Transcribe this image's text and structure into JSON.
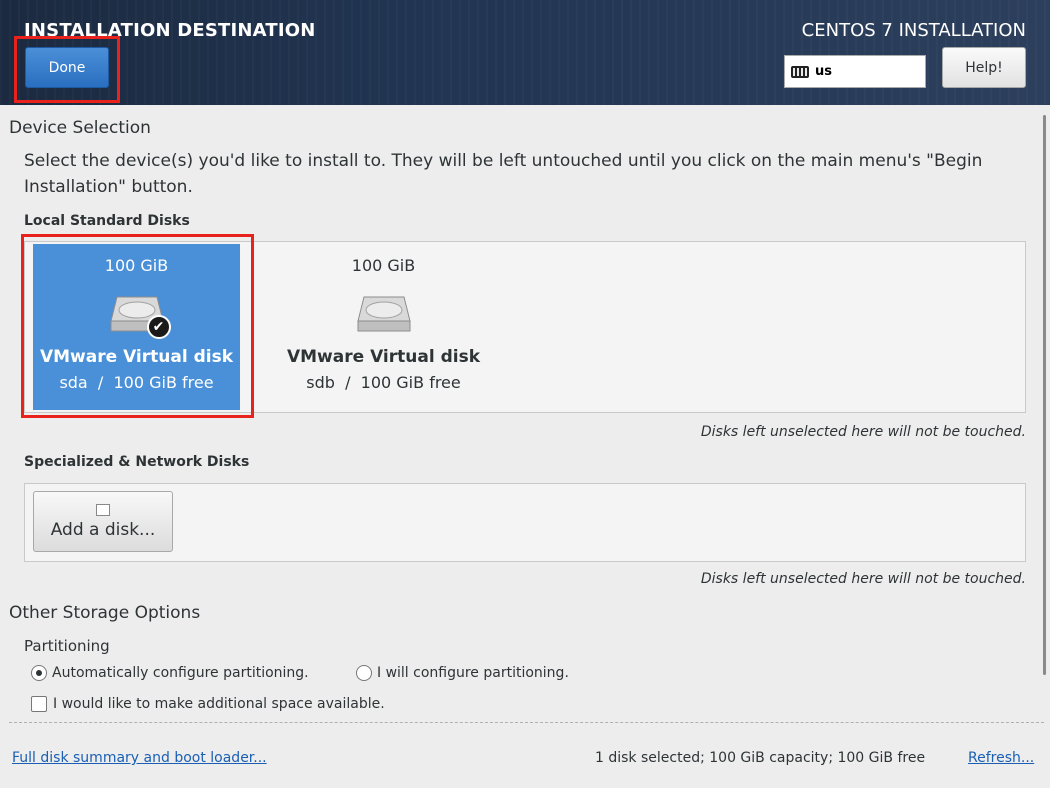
{
  "header": {
    "title": "INSTALLATION DESTINATION",
    "done_label": "Done",
    "product_title": "CENTOS 7 INSTALLATION",
    "keyboard_layout": "us",
    "help_label": "Help!",
    "keyboard_icon": "keyboard-icon"
  },
  "device_selection": {
    "heading": "Device Selection",
    "description": "Select the device(s) you'd like to install to.  They will be left untouched until you click on the main menu's \"Begin Installation\" button.",
    "local_disks_label": "Local Standard Disks",
    "disks": [
      {
        "size": "100 GiB",
        "name": "VMware Virtual disk",
        "device": "sda",
        "separator": "/",
        "free": "100 GiB free",
        "selected": true
      },
      {
        "size": "100 GiB",
        "name": "VMware Virtual disk",
        "device": "sdb",
        "separator": "/",
        "free": "100 GiB free",
        "selected": false
      }
    ],
    "local_note": "Disks left unselected here will not be touched.",
    "network_disks_label": "Specialized & Network Disks",
    "add_disk_label": "Add a disk...",
    "network_note": "Disks left unselected here will not be touched."
  },
  "other_storage": {
    "heading": "Other Storage Options",
    "partitioning_label": "Partitioning",
    "auto_partition_label": "Automatically configure partitioning.",
    "manual_partition_label": "I will configure partitioning.",
    "auto_selected": true,
    "extra_space_label": "I would like to make additional space available.",
    "extra_space_checked": false
  },
  "footer": {
    "summary_link": "Full disk summary and boot loader...",
    "summary_text": "1 disk selected; 100 GiB capacity; 100 GiB free",
    "refresh_link": "Refresh..."
  },
  "colors": {
    "selected_disk": "#4a90d9",
    "highlight": "#e8231d",
    "link": "#1a5fb4"
  }
}
